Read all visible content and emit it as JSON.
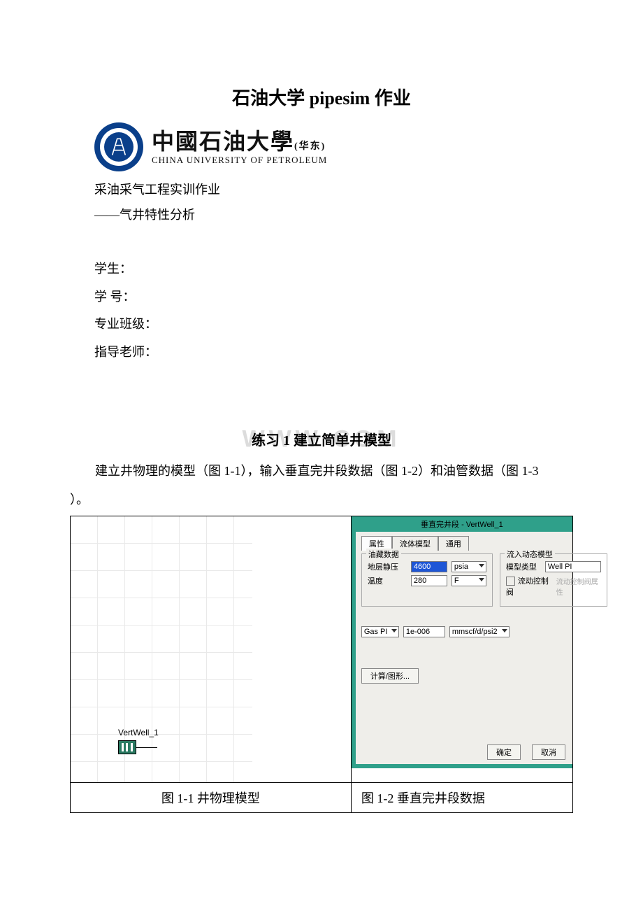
{
  "page": {
    "main_title": "石油大学 pipesim 作业",
    "logo_cn": "中國石油大學",
    "logo_cn_suffix": "(华东)",
    "logo_en": "CHINA UNIVERSITY OF PETROLEUM",
    "subline1": "采油采气工程实训作业",
    "subline2": "——气井特性分析",
    "info_student": "学生：",
    "info_id": "学 号：",
    "info_class": "专业班级：",
    "info_teacher": "指导老师：",
    "watermark": "WWW            COM",
    "ex_title": "练习 1 建立简单井模型",
    "body1": "建立井物理的模型（图 1-1），输入垂直完井段数据（图 1-2）和油管数据（图 1-3",
    "body2": "）。",
    "caption_left": "图 1-1 井物理模型",
    "caption_right": "图 1-2 垂直完井段数据"
  },
  "fig_left": {
    "well_label": "VertWell_1"
  },
  "dialog": {
    "title": "垂直完井段 - VertWell_1",
    "tabs": {
      "t1": "属性",
      "t2": "流体模型",
      "t3": "通用"
    },
    "group_oil": "油藏数据",
    "lbl_pstatic": "地层静压",
    "val_pstatic": "4600",
    "unit_psia": "psia",
    "lbl_temp": "温度",
    "val_temp": "280",
    "unit_f": "F",
    "group_flow": "流入动态模型",
    "lbl_model": "模型类型",
    "val_model": "Well PI",
    "chk_valve": "流动控制阀",
    "disabled_valve": "流动控制阀属性",
    "combo_gaspi": "Gas PI",
    "val_gaspi": "1e-006",
    "unit_gaspi": "mmscf/d/psi2",
    "btn_calc": "计算/图形...",
    "btn_ok": "确定",
    "btn_cancel": "取消"
  }
}
